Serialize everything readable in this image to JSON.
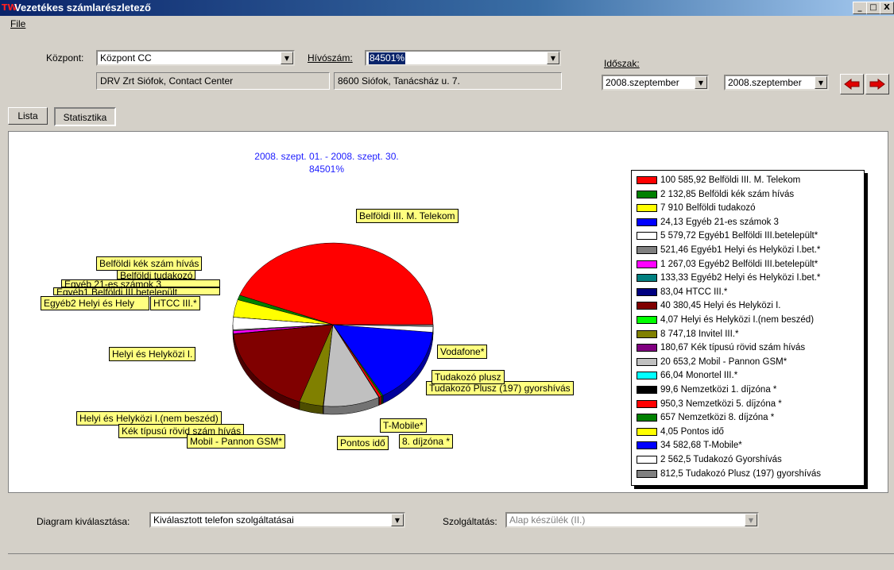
{
  "window": {
    "title": "Vezetékes számlarészletező",
    "min": "_",
    "max": "□",
    "close": "X"
  },
  "menu": {
    "file": "File"
  },
  "form": {
    "kozpont_label": "Központ:",
    "kozpont_value": "Központ CC",
    "hivoszam_label": "Hívószám:",
    "hivoszam_value": "84501%",
    "company": "DRV Zrt Siófok, Contact Center",
    "address": "8600 Siófok, Tanácsház u. 7.",
    "idoszak_label": "Időszak:",
    "period_from": "2008.szeptember",
    "period_to": "2008.szeptember"
  },
  "tabs": [
    {
      "label": "Lista"
    },
    {
      "label": "Statisztika"
    }
  ],
  "chart": {
    "title_line1": "2008. szept. 01. - 2008. szept. 30.",
    "title_line2": "84501%"
  },
  "chart_data": {
    "type": "pie",
    "title": "2008. szept. 01. - 2008. szept. 30. 84501%",
    "legend_position": "right",
    "series": [
      {
        "label": "100 585,92 Belföldi III. M. Telekom",
        "value": 100585.92,
        "color": "#ff0000"
      },
      {
        "label": "2 132,85 Belföldi kék szám hívás",
        "value": 2132.85,
        "color": "#008000"
      },
      {
        "label": "7 910 Belföldi tudakozó",
        "value": 7910,
        "color": "#ffff00"
      },
      {
        "label": "24,13 Egyéb 21-es számok 3",
        "value": 24.13,
        "color": "#0000ff"
      },
      {
        "label": "5 579,72 Egyéb1 Belföldi III.betelepült*",
        "value": 5579.72,
        "color": "#ffffff"
      },
      {
        "label": "521,46 Egyéb1 Helyi és Helyközi I.bet.*",
        "value": 521.46,
        "color": "#808080"
      },
      {
        "label": "1 267,03 Egyéb2 Belföldi III.betelepült*",
        "value": 1267.03,
        "color": "#ff00ff"
      },
      {
        "label": "133,33 Egyéb2 Helyi és Helyközi I.bet.*",
        "value": 133.33,
        "color": "#008080"
      },
      {
        "label": "83,04 HTCC III.*",
        "value": 83.04,
        "color": "#000080"
      },
      {
        "label": "40 380,45 Helyi és Helyközi I.",
        "value": 40380.45,
        "color": "#800000"
      },
      {
        "label": "4,07 Helyi és Helyközi I.(nem beszéd)",
        "value": 4.07,
        "color": "#00ff00"
      },
      {
        "label": "8 747,18 Invitel III.*",
        "value": 8747.18,
        "color": "#808000"
      },
      {
        "label": "180,67 Kék típusú rövid szám hívás",
        "value": 180.67,
        "color": "#800080"
      },
      {
        "label": "20 653,2 Mobil - Pannon GSM*",
        "value": 20653.2,
        "color": "#c0c0c0"
      },
      {
        "label": "66,04 Monortel III.*",
        "value": 66.04,
        "color": "#00ffff"
      },
      {
        "label": "99,6 Nemzetközi 1. díjzóna *",
        "value": 99.6,
        "color": "#000000"
      },
      {
        "label": "950,3 Nemzetközi 5. díjzóna *",
        "value": 950.3,
        "color": "#ff0000"
      },
      {
        "label": "657 Nemzetközi 8. díjzóna *",
        "value": 657,
        "color": "#008000"
      },
      {
        "label": "4,05 Pontos idő",
        "value": 4.05,
        "color": "#ffff00"
      },
      {
        "label": "34 582,68 T-Mobile*",
        "value": 34582.68,
        "color": "#0000ff"
      },
      {
        "label": "2 562,5 Tudakozó Gyorshívás",
        "value": 2562.5,
        "color": "#ffffff"
      },
      {
        "label": "812,5 Tudakozó Plusz (197) gyorshívás",
        "value": 812.5,
        "color": "#808080"
      }
    ],
    "callouts": [
      "Belföldi III. M. Telekom",
      "Belföldi kék szám hívás",
      "Belföldi tudakozó",
      "Egyéb 21-es számok 3",
      "Egyéb1 Belföldi III.betelepült",
      "Egyéb2 Helyi és Hely",
      "HTCC III.*",
      "Vodafone*",
      "Tudakozó plusz",
      "Tudakozó Plusz (197) gyorshívás",
      "Helyi és Helyközi I.",
      "Helyi és Helyközi I.(nem beszéd)",
      "Kék típusú rövid szám hívás",
      "Mobil - Pannon GSM*",
      "T-Mobile*",
      "Pontos idő",
      "8. díjzóna *"
    ]
  },
  "bottom": {
    "diagram_label": "Diagram kiválasztása:",
    "diagram_value": "Kiválasztott telefon szolgáltatásai",
    "szolg_label": "Szolgáltatás:",
    "szolg_value": "Alap készülék (II.)"
  },
  "icons": {
    "prev": "arrow-left-icon",
    "next": "arrow-right-icon",
    "dropdown": "chevron-down-icon"
  }
}
